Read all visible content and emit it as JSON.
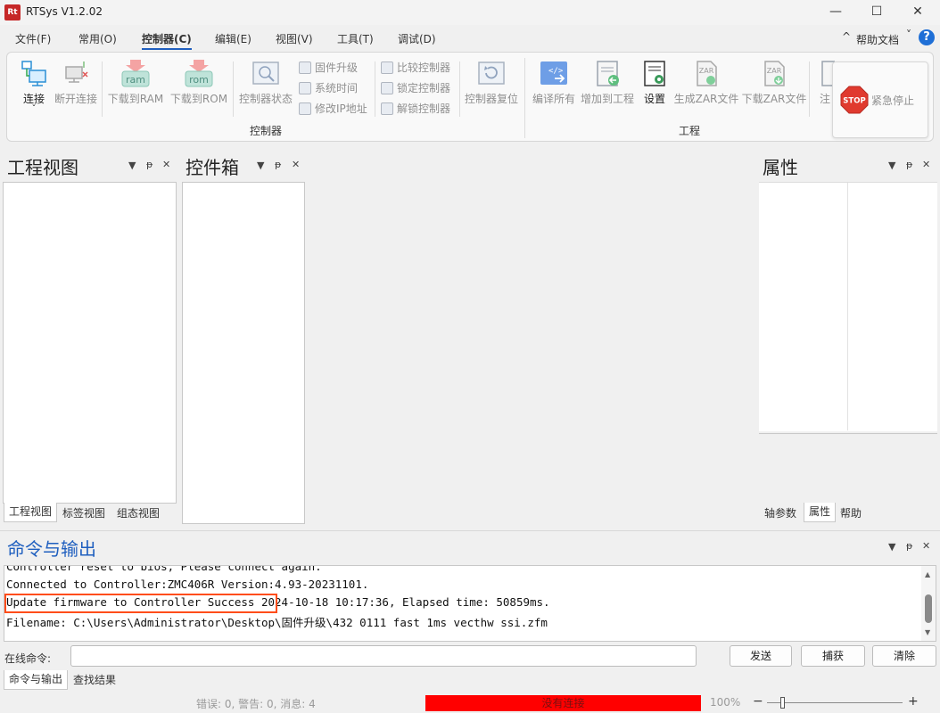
{
  "window": {
    "title": "RTSys V1.2.02",
    "logo_text": "Rt",
    "minimize": "—",
    "maximize": "☐",
    "close": "✕"
  },
  "menu": {
    "items": [
      "文件(F)",
      "常用(O)",
      "控制器(C)",
      "编辑(E)",
      "视图(V)",
      "工具(T)",
      "调试(D)"
    ],
    "help": "帮助文档",
    "help_caret": "^",
    "help_dropdown": "˅",
    "help_icon": "?"
  },
  "ribbon": {
    "controller": {
      "connect": "连接",
      "disconnect": "断开连接",
      "download_ram": "下载到RAM",
      "download_rom": "下载到ROM",
      "ram_icon_text": "ram",
      "rom_icon_text": "rom",
      "status": "控制器状态",
      "firmware": "固件升级",
      "system_time": "系统时间",
      "modify_ip": "修改IP地址",
      "compare": "比较控制器",
      "lock": "锁定控制器",
      "unlock": "解锁控制器",
      "reset": "控制器复位",
      "group_label": "控制器"
    },
    "project": {
      "compile_all": "编译所有",
      "add_to_project": "增加到工程",
      "settings": "设置",
      "gen_zar": "生成ZAR文件",
      "download_zar": "下载ZAR文件",
      "zar_icon_text": "ZAR",
      "note_partial": "注",
      "group_label": "工程"
    },
    "emergency_stop": "紧急停止",
    "stop_text": "STOP"
  },
  "panels": {
    "project_view": {
      "title": "工程视图",
      "tabs": [
        "工程视图",
        "标签视图",
        "组态视图"
      ]
    },
    "toolbox": {
      "title": "控件箱"
    },
    "properties": {
      "title": "属性",
      "tabs": [
        "轴参数",
        "属性",
        "帮助"
      ]
    },
    "controls": {
      "dropdown": "▼",
      "pin": "ᵽ",
      "close": "✕"
    }
  },
  "output": {
    "title": "命令与输出",
    "lines": [
      "Controller reset to bios, Please connect again.",
      "Connected to Controller:ZMC406R Version:4.93-20231101.",
      "Update firmware to Controller Success  2024-10-18 10:17:36, Elapsed time: 50859ms.",
      "Filename: C:\\Users\\Administrator\\Desktop\\固件升级\\432 0111 fast 1ms vecthw ssi.zfm"
    ],
    "command_label": "在线命令:",
    "command_value": "",
    "send": "发送",
    "capture": "捕获",
    "clear": "清除",
    "tabs": [
      "命令与输出",
      "查找结果"
    ]
  },
  "status": {
    "messages": "错误: 0, 警告: 0, 消息: 4",
    "connection": "没有连接",
    "connection_color": "#ff0000",
    "zoom": "100%",
    "zoom_minus": "−",
    "zoom_plus": "+"
  }
}
